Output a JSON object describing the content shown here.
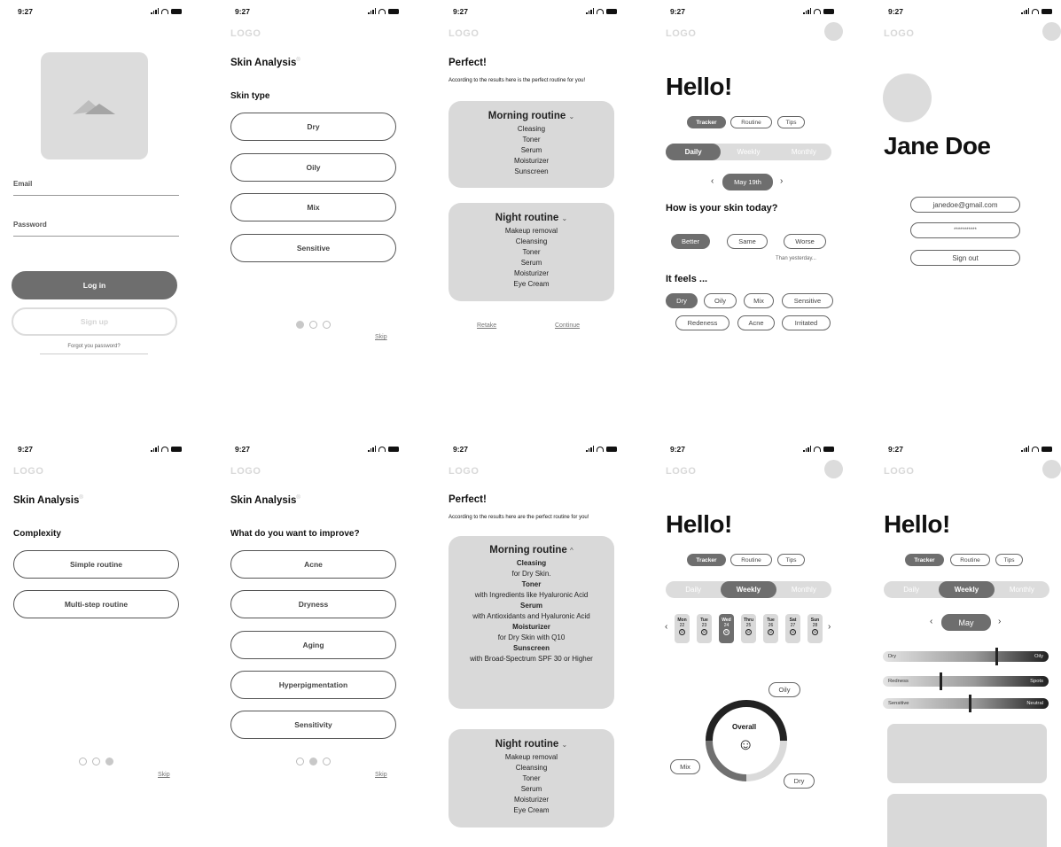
{
  "status": {
    "time": "9:27"
  },
  "logo": "LOGO",
  "login": {
    "email_label": "Email",
    "password_label": "Password",
    "login_button": "Log in",
    "signup_button": "Sign up",
    "forgot": "Forgot you password?"
  },
  "analysis_title": "Skin Analysis",
  "analysis_mark": "®",
  "skin_type": {
    "heading": "Skin type",
    "options": [
      "Dry",
      "Oily",
      "Mix",
      "Sensitive"
    ],
    "skip": "Skip"
  },
  "routine1": {
    "title": "Perfect!",
    "subtitle": "According to the results here is the perfect routine for you!",
    "morning_title": "Morning routine",
    "morning_items": [
      "Cleasing",
      "Toner",
      "Serum",
      "Moisturizer",
      "Sunscreen"
    ],
    "night_title": "Night routine",
    "night_items": [
      "Makeup removal",
      "Cleansing",
      "Toner",
      "Serum",
      "Moisturizer",
      "Eye Cream"
    ],
    "retake": "Retake",
    "continue": "Continue"
  },
  "tracker": {
    "hello": "Hello!",
    "tabs": [
      "Tracker",
      "Routine",
      "Tips"
    ],
    "periods": [
      "Daily",
      "Weekly",
      "Monthly"
    ],
    "date": "May 19th",
    "question": "How is your skin today?",
    "moods": [
      "Better",
      "Same",
      "Worse"
    ],
    "than": "Than yesterday...",
    "feels_heading": "It feels ...",
    "feels": [
      "Dry",
      "Oily",
      "Mix",
      "Sensitive",
      "Redeness",
      "Acne",
      "Irritated"
    ]
  },
  "profile": {
    "name": "Jane Doe",
    "email": "janedoe@gmail.com",
    "password": "***********",
    "signout": "Sign out"
  },
  "complexity": {
    "heading": "Complexity",
    "options": [
      "Simple routine",
      "Multi-step routine"
    ],
    "skip": "Skip"
  },
  "improve": {
    "heading": "What do you want to improve?",
    "options": [
      "Acne",
      "Dryness",
      "Aging",
      "Hyperpigmentation",
      "Sensitivity"
    ],
    "skip": "Skip"
  },
  "routine2": {
    "title": "Perfect!",
    "subtitle": "According to the results here are the perfect routine for you!",
    "morning_title": "Morning routine",
    "morning": [
      {
        "name": "Cleasing",
        "detail": "for Dry Skin."
      },
      {
        "name": "Toner",
        "detail": "with Ingredients like Hyaluronic Acid"
      },
      {
        "name": "Serum",
        "detail": "with Antioxidants and Hyaluronic Acid"
      },
      {
        "name": "Moisturizer",
        "detail": "for Dry Skin with Q10"
      },
      {
        "name": "Sunscreen",
        "detail": "with Broad-Spectrum SPF 30 or Higher"
      }
    ],
    "night_title": "Night routine",
    "night_items": [
      "Makeup removal",
      "Cleansing",
      "Toner",
      "Serum",
      "Moisturizer",
      "Eye Cream"
    ]
  },
  "weekly": {
    "days": [
      {
        "d": "Mon",
        "n": "22"
      },
      {
        "d": "Tue",
        "n": "23"
      },
      {
        "d": "Wed",
        "n": "24"
      },
      {
        "d": "Thru",
        "n": "25"
      },
      {
        "d": "Tue",
        "n": "26"
      },
      {
        "d": "Sat",
        "n": "27"
      },
      {
        "d": "Sun",
        "n": "28"
      }
    ],
    "overall": "Overall",
    "labels": [
      "Oily",
      "Mix",
      "Dry"
    ],
    "face": "☺"
  },
  "monthly": {
    "month": "May",
    "sliders": [
      {
        "left": "Dry",
        "right": "Oily",
        "level": 0.68
      },
      {
        "left": "Redness",
        "right": "Spots",
        "level": 0.34
      },
      {
        "left": "Sensitive",
        "right": "Neutral",
        "level": 0.52
      }
    ]
  },
  "colors": {
    "dark": "#6e6e6e",
    "light": "#d9d9d9"
  }
}
